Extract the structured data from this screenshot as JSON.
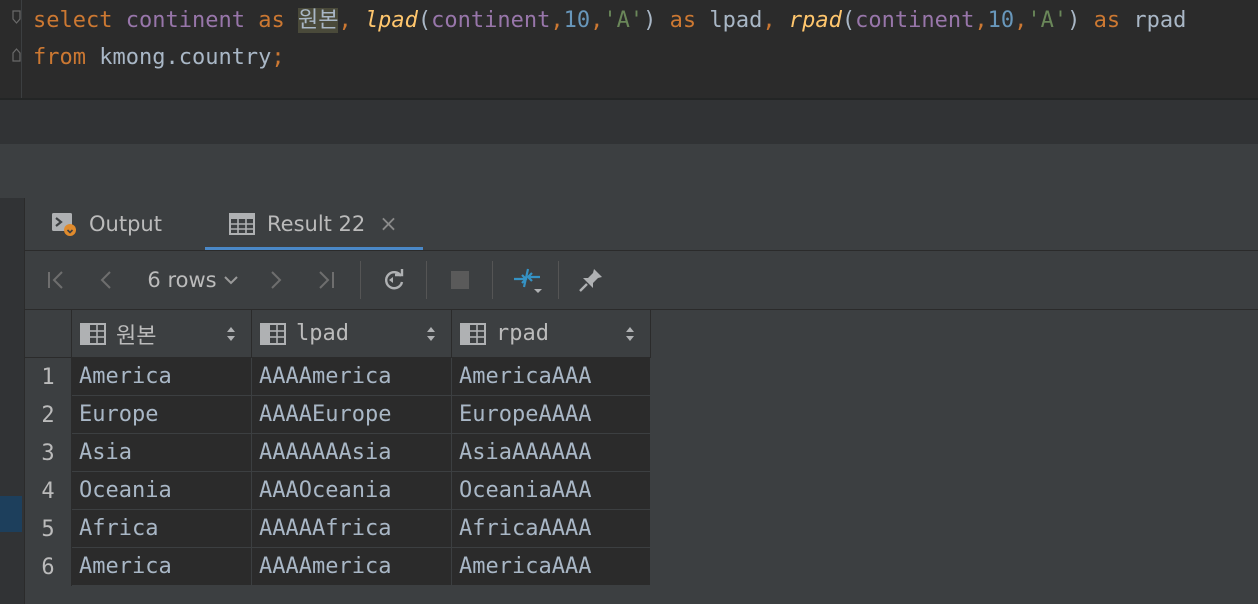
{
  "editor": {
    "line1": {
      "kw_select": "select",
      "col_continent": "continent",
      "kw_as1": "as",
      "alias_orig": "원본",
      "comma1": ",",
      "fn_lpad": "lpad",
      "open1": "(",
      "arg_col1": "continent",
      "c1": ",",
      "num1": "10",
      "c2": ",",
      "str1": "'A'",
      "close1": ")",
      "kw_as2": "as",
      "alias_lpad": "lpad",
      "comma2": ",",
      "fn_rpad": "rpad",
      "open2": "(",
      "arg_col2": "continent",
      "c3": ",",
      "num2": "10",
      "c4": ",",
      "str2": "'A'",
      "close2": ")",
      "kw_as3": "as",
      "alias_rpad": "rpad"
    },
    "line2": {
      "kw_from": "from",
      "table": "kmong.country",
      "semi": ";"
    }
  },
  "tabs": {
    "output": "Output",
    "result": "Result 22",
    "close": "×"
  },
  "toolbar": {
    "rows_label": "6 rows"
  },
  "grid": {
    "columns": [
      "원본",
      "lpad",
      "rpad"
    ],
    "rows": [
      {
        "n": "1",
        "c": [
          "America",
          "AAAAmerica",
          "AmericaAAA"
        ]
      },
      {
        "n": "2",
        "c": [
          "Europe",
          "AAAAEurope",
          "EuropeAAAA"
        ]
      },
      {
        "n": "3",
        "c": [
          "Asia",
          "AAAAAAAsia",
          "AsiaAAAAAA"
        ]
      },
      {
        "n": "4",
        "c": [
          "Oceania",
          "AAAOceania",
          "OceaniaAAA"
        ]
      },
      {
        "n": "5",
        "c": [
          "Africa",
          "AAAAAfrica",
          "AfricaAAAA"
        ]
      },
      {
        "n": "6",
        "c": [
          "America",
          "AAAAmerica",
          "AmericaAAA"
        ]
      }
    ]
  },
  "colors": {
    "accent": "#4a88c7",
    "keyword": "#cc7832",
    "function": "#ffc66d",
    "string": "#6a8759",
    "number": "#6897bb"
  }
}
